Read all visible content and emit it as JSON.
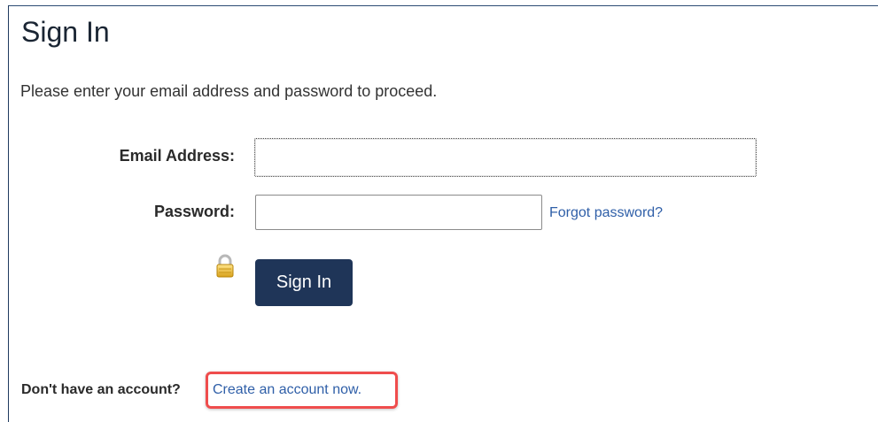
{
  "page": {
    "title": "Sign In",
    "intro": "Please enter your email address and password to proceed."
  },
  "form": {
    "email_label": "Email Address:",
    "email_value": "",
    "password_label": "Password:",
    "password_value": "",
    "forgot_password_link": "Forgot password?",
    "signin_button_label": "Sign In",
    "lock_icon": "lock-icon"
  },
  "footer": {
    "no_account_text": "Don't have an account?",
    "create_account_link": "Create an account now."
  },
  "colors": {
    "button_bg": "#1f3558",
    "link": "#2f5fa8",
    "highlight_border": "#ef4d4d"
  }
}
